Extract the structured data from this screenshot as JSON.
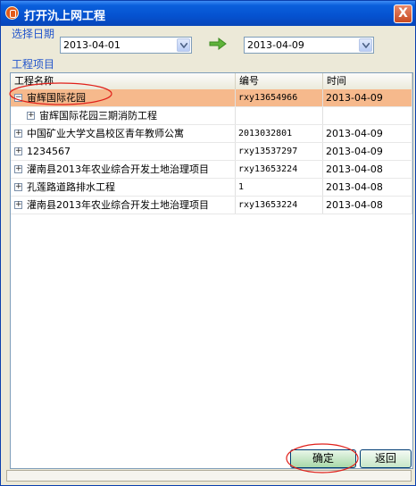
{
  "window": {
    "title": "打开氿上网工程",
    "close_label": "X"
  },
  "date_section": {
    "label": "选择日期",
    "start_date": "2013-04-01",
    "end_date": "2013-04-09"
  },
  "project_section": {
    "label": "工程项目"
  },
  "table": {
    "headers": {
      "name": "工程名称",
      "number": "编号",
      "time": "时间"
    },
    "rows": [
      {
        "name": "宙辉国际花园",
        "number": "rxy13654966",
        "time": "2013-04-09",
        "expander": "−",
        "indent": 0,
        "selected": true
      },
      {
        "name": "宙辉国际花园三期消防工程",
        "number": "",
        "time": "",
        "expander": "+",
        "indent": 1,
        "selected": false
      },
      {
        "name": "中国矿业大学文昌校区青年教师公寓",
        "number": "2013032801",
        "time": "2013-04-09",
        "expander": "+",
        "indent": 0,
        "selected": false
      },
      {
        "name": "1234567",
        "number": "rxy13537297",
        "time": "2013-04-09",
        "expander": "+",
        "indent": 0,
        "selected": false
      },
      {
        "name": "灌南县2013年农业综合开发土地治理项目",
        "number": "rxy13653224",
        "time": "2013-04-08",
        "expander": "+",
        "indent": 0,
        "selected": false
      },
      {
        "name": "孔莲路道路排水工程",
        "number": "1",
        "time": "2013-04-08",
        "expander": "+",
        "indent": 0,
        "selected": false
      },
      {
        "name": "灌南县2013年农业综合开发土地治理项目",
        "number": "rxy13653224",
        "time": "2013-04-08",
        "expander": "+",
        "indent": 0,
        "selected": false
      }
    ]
  },
  "buttons": {
    "ok": "确定",
    "back": "返回"
  },
  "colors": {
    "title_bar": "#0552d0",
    "selection": "#f6b98c",
    "section_label": "#2255cc",
    "annotation": "#e0201a"
  }
}
